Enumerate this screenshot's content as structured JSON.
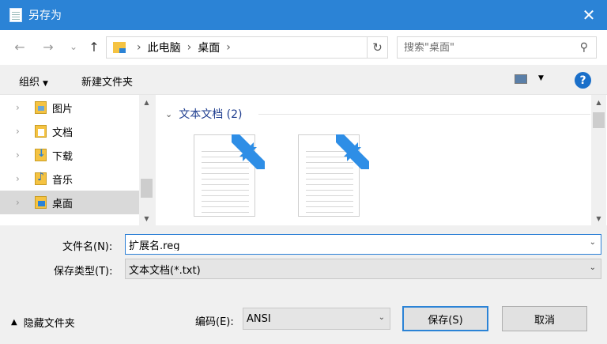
{
  "window": {
    "title": "另存为",
    "close_glyph": "✕"
  },
  "address": {
    "back_glyph": "←",
    "forward_glyph": "→",
    "recent_glyph": "⌄",
    "up_glyph": "↑",
    "crumbs": [
      "此电脑",
      "桌面"
    ],
    "separator": "›",
    "refresh_glyph": "↻"
  },
  "search": {
    "placeholder": "搜索\"桌面\"",
    "icon_glyph": "⚲"
  },
  "toolbar": {
    "organize_label": "组织",
    "organize_caret": "▼",
    "new_folder_label": "新建文件夹",
    "view_caret": "▼",
    "help_label": "?"
  },
  "nav": {
    "items": [
      {
        "label": "图片",
        "icon": "pictures-folder-icon"
      },
      {
        "label": "文档",
        "icon": "documents-folder-icon"
      },
      {
        "label": "下载",
        "icon": "downloads-folder-icon"
      },
      {
        "label": "音乐",
        "icon": "music-folder-icon"
      },
      {
        "label": "桌面",
        "icon": "desktop-folder-icon",
        "selected": true
      }
    ],
    "chevron": "›"
  },
  "content": {
    "group_title": "文本文档 (2)",
    "group_chevron": "⌄",
    "files": [
      {
        "icon": "text-document-shortcut-icon"
      },
      {
        "icon": "text-document-shortcut-icon"
      }
    ]
  },
  "form": {
    "filename_label": "文件名(N):",
    "filename_value": "扩展名.reg",
    "filetype_label": "保存类型(T):",
    "filetype_value": "文本文档(*.txt)",
    "dropdown_glyph": "⌄",
    "hide_folders_label": "隐藏文件夹",
    "hide_folders_glyph": "▲",
    "encoding_label": "编码(E):",
    "encoding_value": "ANSI",
    "save_label": "保存(S)",
    "cancel_label": "取消"
  },
  "colors": {
    "accent": "#2b83d6",
    "selection": "#d9d9d9",
    "group_header": "#1e3d8f"
  }
}
